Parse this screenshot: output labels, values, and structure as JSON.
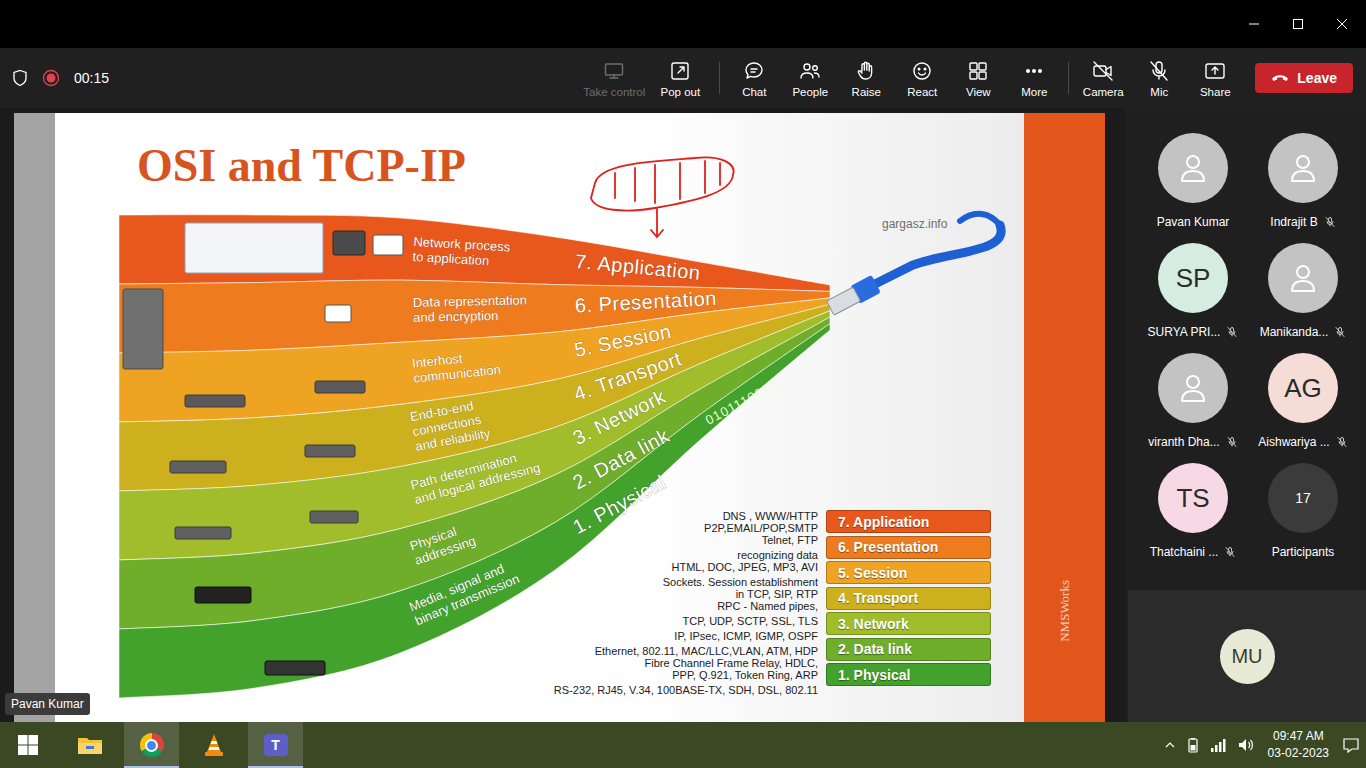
{
  "meeting": {
    "timer": "00:15",
    "recording": true
  },
  "toolbar": [
    {
      "label": "Take control",
      "kind": "control",
      "disabled": true,
      "off": false
    },
    {
      "label": "Pop out",
      "kind": "popout",
      "disabled": false,
      "off": false
    },
    {
      "label": "Chat",
      "kind": "chat",
      "disabled": false,
      "off": false
    },
    {
      "label": "People",
      "kind": "people",
      "disabled": false,
      "off": false
    },
    {
      "label": "Raise",
      "kind": "hand",
      "disabled": false,
      "off": false
    },
    {
      "label": "React",
      "kind": "smile",
      "disabled": false,
      "off": false
    },
    {
      "label": "View",
      "kind": "grid",
      "disabled": false,
      "off": false
    },
    {
      "label": "More",
      "kind": "dots",
      "disabled": false,
      "off": false
    },
    {
      "label": "Camera",
      "kind": "camera",
      "disabled": false,
      "off": true
    },
    {
      "label": "Mic",
      "kind": "mic",
      "disabled": false,
      "off": true
    },
    {
      "label": "Share",
      "kind": "share",
      "disabled": false,
      "off": false
    }
  ],
  "leave": {
    "label": "Leave"
  },
  "slide": {
    "title": "OSI and TCP-IP",
    "source": "gargasz.info",
    "binary": "0101110010",
    "brand": "NMSWorks",
    "layers": [
      {
        "name": "7. Application",
        "description": [
          "Network process",
          "to application"
        ],
        "protocols": [
          "DNS , WWW/HTTP",
          "P2P,EMAIL/POP,SMTP",
          "Telnet, FTP"
        ],
        "color": "#e8581c"
      },
      {
        "name": "6. Presentation",
        "description": [
          "Data representation",
          "and encryption"
        ],
        "protocols": [
          "recognizing data",
          "HTML, DOC, JPEG, MP3, AVI"
        ],
        "color": "#ee7c1f"
      },
      {
        "name": "5. Session",
        "description": [
          "Interhost",
          "communication"
        ],
        "protocols": [
          "Sockets. Session establishment",
          "in TCP, SIP, RTP",
          "RPC - Named pipes,"
        ],
        "color": "#eea322"
      },
      {
        "name": "4. Transport",
        "description": [
          "End-to-end",
          "connections",
          "and reliability"
        ],
        "protocols": [
          "TCP, UDP, SCTP, SSL, TLS"
        ],
        "color": "#cdb01e"
      },
      {
        "name": "3. Network",
        "description": [
          "Path determination",
          "and logical addressing"
        ],
        "protocols": [
          "IP, IPsec, ICMP, IGMP, OSPF"
        ],
        "color": "#a2bd2b"
      },
      {
        "name": "2. Data link",
        "description": [
          "Physical",
          "addressing"
        ],
        "protocols": [
          "Ethernet, 802.11, MAC/LLC,VLAN, ATM, HDP",
          "Fibre Channel Frame Relay, HDLC,",
          "PPP, Q.921, Token Ring, ARP"
        ],
        "color": "#6fae2b"
      },
      {
        "name": "1. Physical",
        "description": [
          "Media, signal and",
          "binary transmission"
        ],
        "protocols": [
          "RS-232, RJ45, V.34, 100BASE-TX, SDH, DSL, 802.11"
        ],
        "color": "#43a22b"
      }
    ]
  },
  "participants": [
    {
      "name": "Pavan Kumar",
      "kind": "icon",
      "initials": "",
      "color": "#c3c3c3",
      "muted": false
    },
    {
      "name": "Indrajit B",
      "kind": "icon",
      "initials": "",
      "color": "#c3c3c3",
      "muted": true
    },
    {
      "name": "SURYA PRI...",
      "kind": "initials",
      "initials": "SP",
      "color": "#d5ede0",
      "muted": true
    },
    {
      "name": "Manikanda...",
      "kind": "icon",
      "initials": "",
      "color": "#c3c3c3",
      "muted": true
    },
    {
      "name": "viranth Dha...",
      "kind": "icon",
      "initials": "",
      "color": "#c3c3c3",
      "muted": true
    },
    {
      "name": "Aishwariya ...",
      "kind": "initials",
      "initials": "AG",
      "color": "#f6dcd7",
      "muted": true
    },
    {
      "name": "Thatchaini ...",
      "kind": "initials",
      "initials": "TS",
      "color": "#f7d8e5",
      "muted": true
    }
  ],
  "overflow": {
    "count": "17",
    "label": "Participants"
  },
  "self": {
    "initials": "MU"
  },
  "presenter": "Pavan Kumar",
  "taskbar": {
    "apps": [
      {
        "kind": "start",
        "selected": false,
        "mark": ""
      },
      {
        "kind": "explorer",
        "selected": false,
        "mark": ""
      },
      {
        "kind": "chrome",
        "selected": true,
        "mark": ""
      },
      {
        "kind": "vlc",
        "selected": false,
        "mark": ""
      },
      {
        "kind": "teams",
        "selected": true,
        "mark": "T"
      }
    ],
    "clock": {
      "time": "09:47 AM",
      "date": "03-02-2023"
    }
  }
}
